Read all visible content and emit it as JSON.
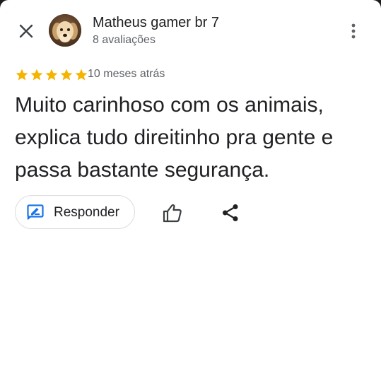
{
  "reviewer": {
    "name": "Matheus gamer br 7",
    "reviews_count": "8 avaliações"
  },
  "review": {
    "rating": 5,
    "time": "10 meses atrás",
    "text": "Muito carinhoso com os animais, explica tudo direitinho pra gente e passa bastante segurança."
  },
  "actions": {
    "reply_label": "Responder"
  },
  "colors": {
    "star": "#f4b400",
    "reply_icon": "#1a73e8",
    "text": "#202124",
    "secondary_text": "#5f6368"
  },
  "icons": [
    "close-icon",
    "more-vert-icon",
    "star-icon",
    "reply-icon",
    "thumb-up-icon",
    "share-icon"
  ]
}
